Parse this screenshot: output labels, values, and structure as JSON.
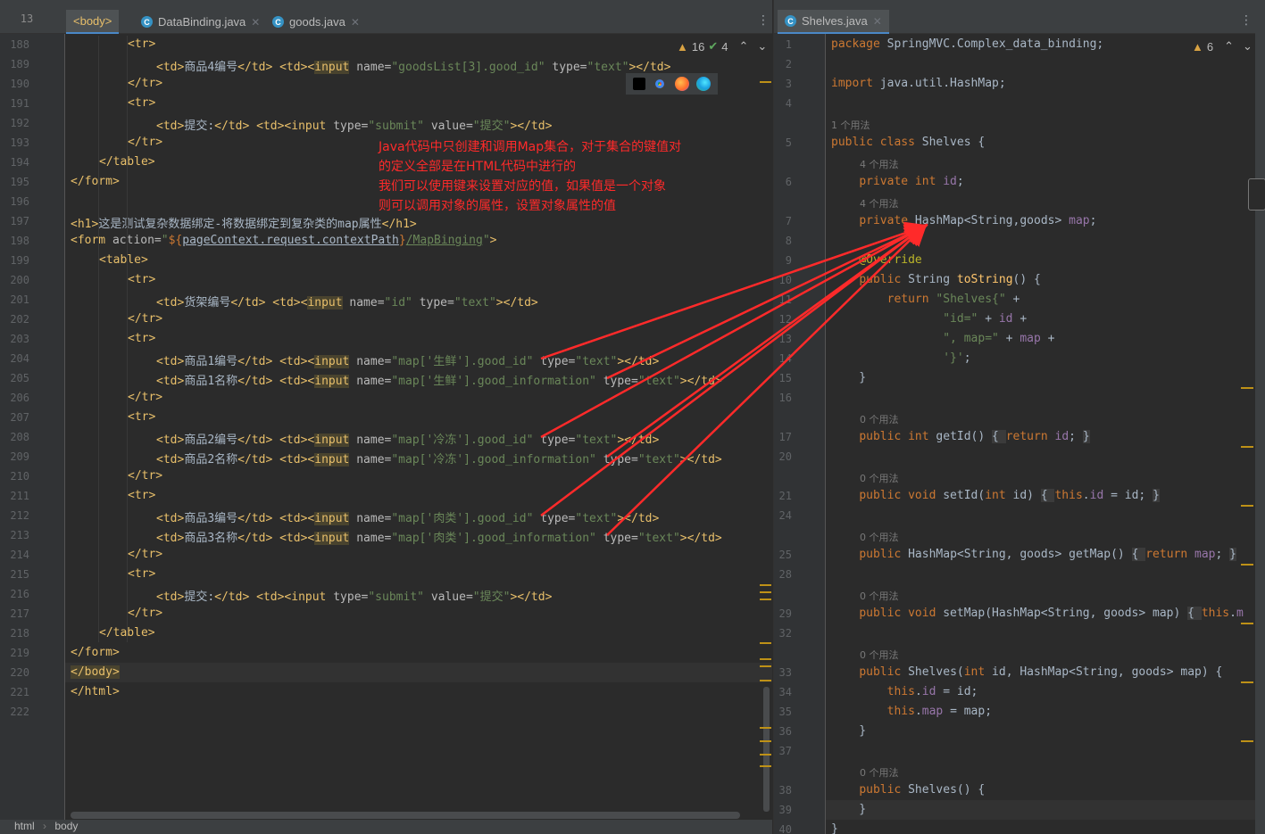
{
  "left_editor": {
    "tabs": [
      {
        "label": "<body>",
        "active": true
      },
      {
        "label": "DataBinding.java",
        "active": false
      },
      {
        "label": "goods.java",
        "active": false
      }
    ],
    "top_line_number": "13",
    "warnings": {
      "warning_count": "16",
      "ok_count": "4"
    },
    "lines": [
      {
        "n": "188",
        "html": "<span class='k'>&lt;tr&gt;</span>",
        "indent": 2
      },
      {
        "n": "189",
        "html": "<span class='k'>&lt;td&gt;</span>商品4编号<span class='k'>&lt;/td&gt;</span> <span class='k'>&lt;td&gt;&lt;</span><span class='hl'>input</span> <span class='a'>name=</span><span class='v'>\"goodsList[3].good_id\"</span> <span class='a'>type=</span><span class='v'>\"text\"</span><span class='k'>&gt;&lt;/td&gt;</span>",
        "indent": 3
      },
      {
        "n": "190",
        "html": "<span class='k'>&lt;/tr&gt;</span>",
        "indent": 2
      },
      {
        "n": "191",
        "html": "<span class='k'>&lt;tr&gt;</span>",
        "indent": 2
      },
      {
        "n": "192",
        "html": "<span class='k'>&lt;td&gt;</span>提交:<span class='k'>&lt;/td&gt;</span> <span class='k'>&lt;td&gt;&lt;input</span> <span class='a'>type=</span><span class='v'>\"submit\"</span> <span class='a'>value=</span><span class='v'>\"提交\"</span><span class='k'>&gt;&lt;/td&gt;</span>",
        "indent": 3
      },
      {
        "n": "193",
        "html": "<span class='k'>&lt;/tr&gt;</span>",
        "indent": 2
      },
      {
        "n": "194",
        "html": "<span class='k'>&lt;/table&gt;</span>",
        "indent": 1
      },
      {
        "n": "195",
        "html": "<span class='k'>&lt;/form&gt;</span>",
        "indent": 0
      },
      {
        "n": "196",
        "html": "",
        "indent": 0
      },
      {
        "n": "197",
        "html": "<span class='k'>&lt;h1&gt;</span>这是测试复杂数据绑定-将数据绑定到复杂类的map属性<span class='k'>&lt;/h1&gt;</span>",
        "indent": 0
      },
      {
        "n": "198",
        "html": "<span class='k'>&lt;form</span> <span class='a'>action=</span><span class='v'>\"</span><span class='kw'>${</span><span class='t' style='text-decoration:underline'>pageContext.request.contextPath</span><span class='kw'>}</span><span class='v' style='text-decoration:underline'>/MapBinging</span><span class='v'>\"</span><span class='k'>&gt;</span>",
        "indent": 0
      },
      {
        "n": "199",
        "html": "<span class='k'>&lt;table&gt;</span>",
        "indent": 1
      },
      {
        "n": "200",
        "html": "<span class='k'>&lt;tr&gt;</span>",
        "indent": 2
      },
      {
        "n": "201",
        "html": "<span class='k'>&lt;td&gt;</span>货架编号<span class='k'>&lt;/td&gt;</span> <span class='k'>&lt;td&gt;&lt;</span><span class='hl'>input</span> <span class='a'>name=</span><span class='v'>\"id\"</span> <span class='a'>type=</span><span class='v'>\"text\"</span><span class='k'>&gt;&lt;/td&gt;</span>",
        "indent": 3
      },
      {
        "n": "202",
        "html": "<span class='k'>&lt;/tr&gt;</span>",
        "indent": 2
      },
      {
        "n": "203",
        "html": "<span class='k'>&lt;tr&gt;</span>",
        "indent": 2
      },
      {
        "n": "204",
        "html": "<span class='k'>&lt;td&gt;</span>商品1编号<span class='k'>&lt;/td&gt;</span> <span class='k'>&lt;td&gt;&lt;</span><span class='hl'>input</span> <span class='a'>name=</span><span class='v'>\"map['生鲜'].good_id\"</span> <span class='a'>type=</span><span class='v'>\"text\"</span><span class='k'>&gt;&lt;/td&gt;</span>",
        "indent": 3
      },
      {
        "n": "205",
        "html": "<span class='k'>&lt;td&gt;</span>商品1名称<span class='k'>&lt;/td&gt;</span> <span class='k'>&lt;td&gt;&lt;</span><span class='hl'>input</span> <span class='a'>name=</span><span class='v'>\"map['生鲜'].good_information\"</span> <span class='a'>type=</span><span class='v'>\"text\"</span><span class='k'>&gt;&lt;/td&gt;</span>",
        "indent": 3
      },
      {
        "n": "206",
        "html": "<span class='k'>&lt;/tr&gt;</span>",
        "indent": 2
      },
      {
        "n": "207",
        "html": "<span class='k'>&lt;tr&gt;</span>",
        "indent": 2
      },
      {
        "n": "208",
        "html": "<span class='k'>&lt;td&gt;</span>商品2编号<span class='k'>&lt;/td&gt;</span> <span class='k'>&lt;td&gt;&lt;</span><span class='hl'>input</span> <span class='a'>name=</span><span class='v'>\"map['冷冻'].good_id\"</span> <span class='a'>type=</span><span class='v'>\"text\"</span><span class='k'>&gt;&lt;/td&gt;</span>",
        "indent": 3
      },
      {
        "n": "209",
        "html": "<span class='k'>&lt;td&gt;</span>商品2名称<span class='k'>&lt;/td&gt;</span> <span class='k'>&lt;td&gt;&lt;</span><span class='hl'>input</span> <span class='a'>name=</span><span class='v'>\"map['冷冻'].good_information\"</span> <span class='a'>type=</span><span class='v'>\"text\"</span><span class='k'>&gt;&lt;/td&gt;</span>",
        "indent": 3
      },
      {
        "n": "210",
        "html": "<span class='k'>&lt;/tr&gt;</span>",
        "indent": 2
      },
      {
        "n": "211",
        "html": "<span class='k'>&lt;tr&gt;</span>",
        "indent": 2
      },
      {
        "n": "212",
        "html": "<span class='k'>&lt;td&gt;</span>商品3编号<span class='k'>&lt;/td&gt;</span> <span class='k'>&lt;td&gt;&lt;</span><span class='hl'>input</span> <span class='a'>name=</span><span class='v'>\"map['肉类'].good_id\"</span> <span class='a'>type=</span><span class='v'>\"text\"</span><span class='k'>&gt;&lt;/td&gt;</span>",
        "indent": 3
      },
      {
        "n": "213",
        "html": "<span class='k'>&lt;td&gt;</span>商品3名称<span class='k'>&lt;/td&gt;</span> <span class='k'>&lt;td&gt;&lt;</span><span class='hl'>input</span> <span class='a'>name=</span><span class='v'>\"map['肉类'].good_information\"</span> <span class='a'>type=</span><span class='v'>\"text\"</span><span class='k'>&gt;&lt;/td&gt;</span>",
        "indent": 3
      },
      {
        "n": "214",
        "html": "<span class='k'>&lt;/tr&gt;</span>",
        "indent": 2
      },
      {
        "n": "215",
        "html": "<span class='k'>&lt;tr&gt;</span>",
        "indent": 2
      },
      {
        "n": "216",
        "html": "<span class='k'>&lt;td&gt;</span>提交:<span class='k'>&lt;/td&gt;</span> <span class='k'>&lt;td&gt;&lt;input</span> <span class='a'>type=</span><span class='v'>\"submit\"</span> <span class='a'>value=</span><span class='v'>\"提交\"</span><span class='k'>&gt;&lt;/td&gt;</span>",
        "indent": 3
      },
      {
        "n": "217",
        "html": "<span class='k'>&lt;/tr&gt;</span>",
        "indent": 2
      },
      {
        "n": "218",
        "html": "<span class='k'>&lt;/table&gt;</span>",
        "indent": 1
      },
      {
        "n": "219",
        "html": "<span class='k'>&lt;/form&gt;</span>",
        "indent": 0
      },
      {
        "n": "220",
        "html": "<span class='hl'>&lt;/body&gt;</span>",
        "indent": 0
      },
      {
        "n": "221",
        "html": "<span class='k'>&lt;/html&gt;</span>",
        "indent": 0
      },
      {
        "n": "222",
        "html": "",
        "indent": 0
      }
    ],
    "annotation": [
      "Java代码中只创建和调用Map集合，对于集合的键值对",
      "的定义全部是在HTML代码中进行的",
      "我们可以使用键来设置对应的值，如果值是一个对象",
      "则可以调用对象的属性，设置对象属性的值"
    ],
    "breadcrumb": [
      "html",
      "body"
    ]
  },
  "right_editor": {
    "tab": {
      "label": "Shelves.java"
    },
    "warnings": {
      "warning_count": "6"
    },
    "lines": [
      {
        "n": "1",
        "html": "<span class='kw'>package</span> SpringMVC.Complex_data_binding;"
      },
      {
        "n": "2",
        "html": ""
      },
      {
        "n": "3",
        "html": "<span class='kw'>import</span> java.util.HashMap;"
      },
      {
        "n": "4",
        "html": ""
      },
      {
        "n": "",
        "hint": "1 个用法",
        "indent": 0
      },
      {
        "n": "5",
        "html": "<span class='kw'>public class</span> Shelves {"
      },
      {
        "n": "",
        "hint": "4 个用法",
        "indent": 1
      },
      {
        "n": "6",
        "html": "    <span class='kw'>private int</span> <span class='fld'>id</span>;"
      },
      {
        "n": "",
        "hint": "4 个用法",
        "indent": 1
      },
      {
        "n": "7",
        "html": "    <span class='kw'>private</span> HashMap&lt;String,goods&gt; <span class='fld'>map</span>;"
      },
      {
        "n": "8",
        "html": ""
      },
      {
        "n": "9",
        "html": "    <span class='ann'>@Override</span>"
      },
      {
        "n": "10",
        "html": "    <span class='kw'>public</span> String <span class='fn'>toString</span>() {"
      },
      {
        "n": "11",
        "html": "        <span class='kw'>return</span> <span class='str'>\"Shelves{\"</span> +"
      },
      {
        "n": "12",
        "html": "                <span class='str'>\"id=\"</span> + <span class='fld'>id</span> +"
      },
      {
        "n": "13",
        "html": "                <span class='str'>\", map=\"</span> + <span class='fld'>map</span> +"
      },
      {
        "n": "14",
        "html": "                <span class='str'>'}'</span>;"
      },
      {
        "n": "15",
        "html": "    }"
      },
      {
        "n": "16",
        "html": ""
      },
      {
        "n": "",
        "hint": "0 个用法",
        "indent": 1
      },
      {
        "n": "17",
        "html": "    <span class='kw'>public int</span> getId() <span style='background:#3b3b3b'>{ </span><span class='kw'>return</span> <span class='fld'>id</span>; <span style='background:#3b3b3b'>}</span>"
      },
      {
        "n": "20",
        "html": ""
      },
      {
        "n": "",
        "hint": "0 个用法",
        "indent": 1
      },
      {
        "n": "21",
        "html": "    <span class='kw'>public void</span> setId(<span class='kw'>int</span> id) <span style='background:#3b3b3b'>{ </span><span class='kw'>this</span>.<span class='fld'>id</span> = id; <span style='background:#3b3b3b'>}</span>"
      },
      {
        "n": "24",
        "html": ""
      },
      {
        "n": "",
        "hint": "0 个用法",
        "indent": 1
      },
      {
        "n": "25",
        "html": "    <span class='kw'>public</span> HashMap&lt;String, goods&gt; getMap() <span style='background:#3b3b3b'>{ </span><span class='kw'>return</span> <span class='fld'>map</span>; <span style='background:#3b3b3b'>}</span>"
      },
      {
        "n": "28",
        "html": ""
      },
      {
        "n": "",
        "hint": "0 个用法",
        "indent": 1
      },
      {
        "n": "29",
        "html": "    <span class='kw'>public void</span> setMap(HashMap&lt;String, goods&gt; map) <span style='background:#3b3b3b'>{ </span><span class='kw'>this</span>.<span class='fld'>m</span>"
      },
      {
        "n": "32",
        "html": ""
      },
      {
        "n": "",
        "hint": "0 个用法",
        "indent": 1
      },
      {
        "n": "33",
        "html": "    <span class='kw'>public</span> Shelves(<span class='kw'>int</span> id, HashMap&lt;String, goods&gt; map) {"
      },
      {
        "n": "34",
        "html": "        <span class='kw'>this</span>.<span class='fld'>id</span> = id;"
      },
      {
        "n": "35",
        "html": "        <span class='kw'>this</span>.<span class='fld'>map</span> = map;"
      },
      {
        "n": "36",
        "html": "    }"
      },
      {
        "n": "37",
        "html": ""
      },
      {
        "n": "",
        "hint": "0 个用法",
        "indent": 1
      },
      {
        "n": "38",
        "html": "    <span class='kw'>public</span> Shelves() {"
      },
      {
        "n": "39",
        "html": "    }"
      },
      {
        "n": "40",
        "html": "}"
      }
    ]
  },
  "colors": {
    "annotation": "#ff2a2a",
    "accent": "#4a88c7"
  },
  "icons": [
    "intellij-icon",
    "chrome-icon",
    "firefox-icon",
    "edge-icon"
  ]
}
